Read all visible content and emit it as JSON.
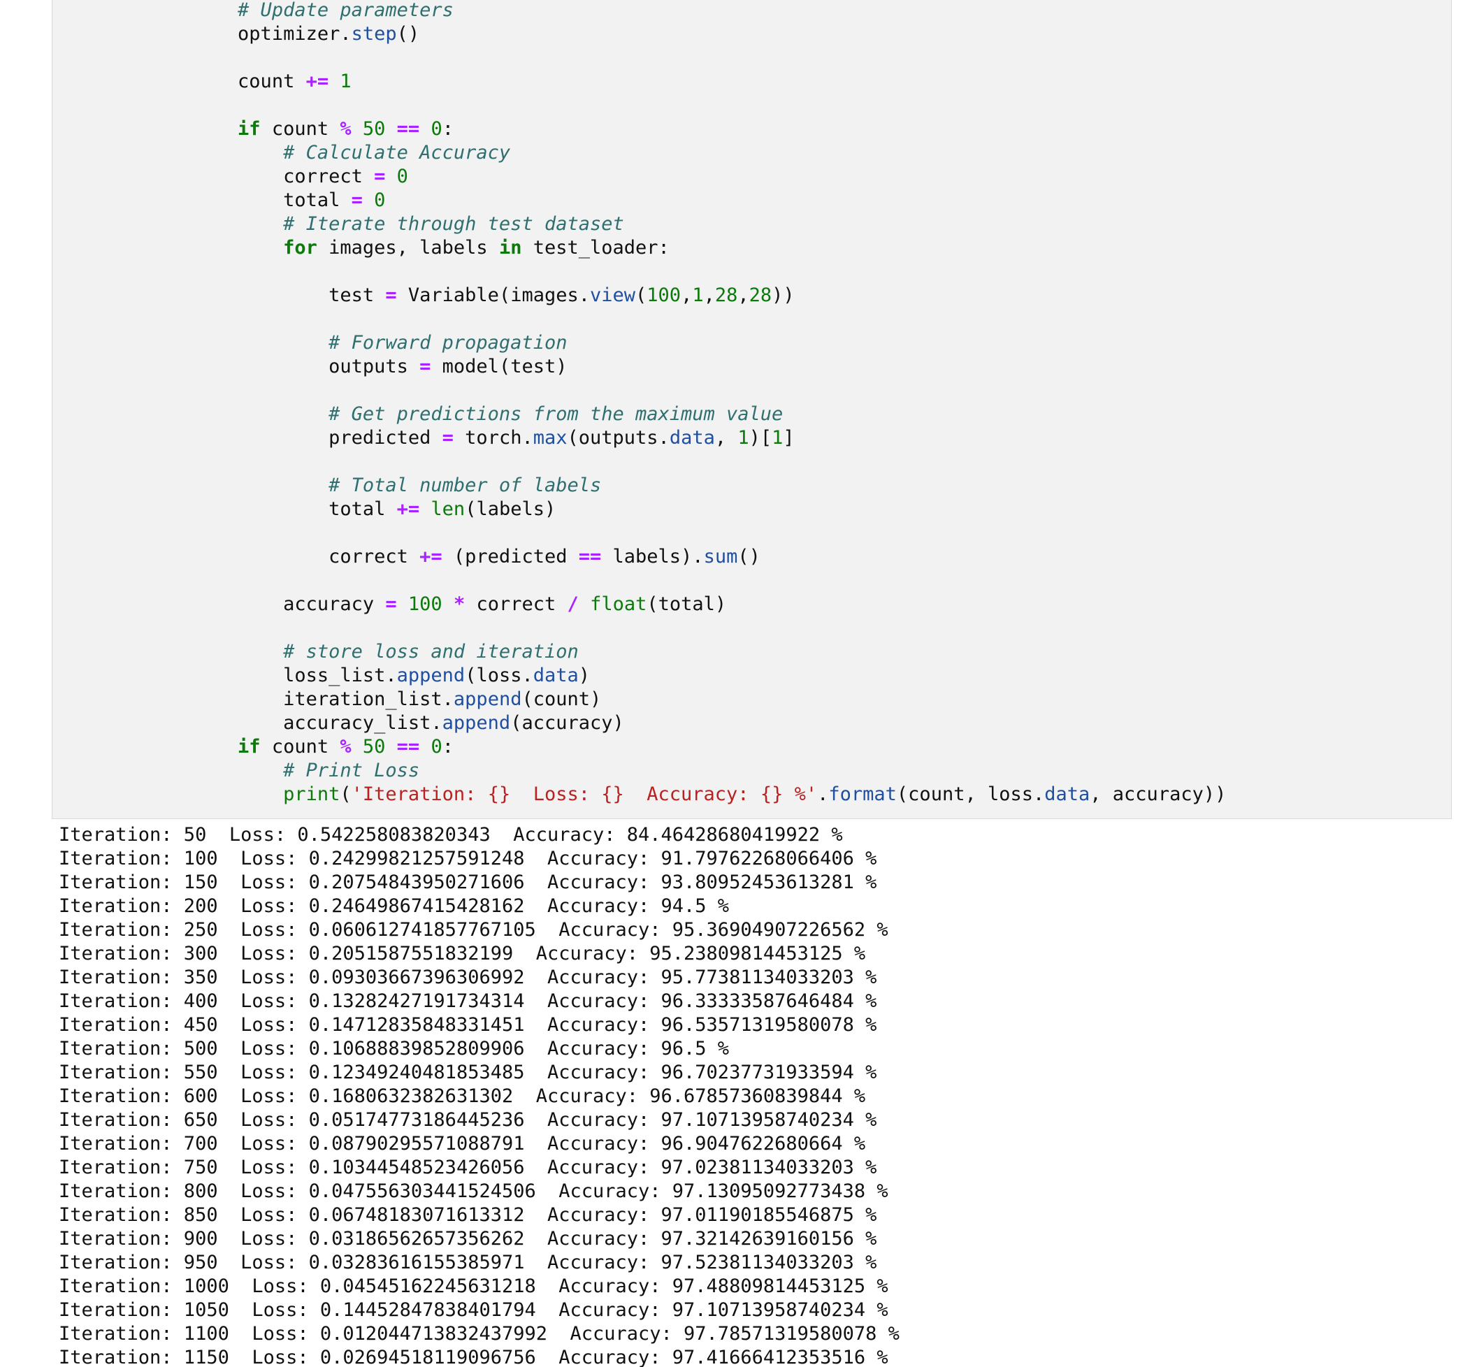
{
  "code_cell": {
    "lines": [
      {
        "indent": "        ",
        "tokens": [
          {
            "t": "# Update parameters",
            "c": "cm"
          }
        ]
      },
      {
        "indent": "        ",
        "tokens": [
          {
            "t": "optimizer.",
            "c": ""
          },
          {
            "t": "step",
            "c": "at"
          },
          {
            "t": "()",
            "c": ""
          }
        ]
      },
      {
        "indent": "",
        "tokens": []
      },
      {
        "indent": "        ",
        "tokens": [
          {
            "t": "count ",
            "c": ""
          },
          {
            "t": "+=",
            "c": "op"
          },
          {
            "t": " ",
            "c": ""
          },
          {
            "t": "1",
            "c": "num"
          }
        ]
      },
      {
        "indent": "",
        "tokens": []
      },
      {
        "indent": "        ",
        "tokens": [
          {
            "t": "if",
            "c": "kw"
          },
          {
            "t": " count ",
            "c": ""
          },
          {
            "t": "%",
            "c": "op"
          },
          {
            "t": " ",
            "c": ""
          },
          {
            "t": "50",
            "c": "num"
          },
          {
            "t": " ",
            "c": ""
          },
          {
            "t": "==",
            "c": "op"
          },
          {
            "t": " ",
            "c": ""
          },
          {
            "t": "0",
            "c": "num"
          },
          {
            "t": ":",
            "c": ""
          }
        ]
      },
      {
        "indent": "            ",
        "tokens": [
          {
            "t": "# Calculate Accuracy",
            "c": "cm"
          }
        ]
      },
      {
        "indent": "            ",
        "tokens": [
          {
            "t": "correct ",
            "c": ""
          },
          {
            "t": "=",
            "c": "op"
          },
          {
            "t": " ",
            "c": ""
          },
          {
            "t": "0",
            "c": "num"
          }
        ]
      },
      {
        "indent": "            ",
        "tokens": [
          {
            "t": "total ",
            "c": ""
          },
          {
            "t": "=",
            "c": "op"
          },
          {
            "t": " ",
            "c": ""
          },
          {
            "t": "0",
            "c": "num"
          }
        ]
      },
      {
        "indent": "            ",
        "tokens": [
          {
            "t": "# Iterate through test dataset",
            "c": "cm"
          }
        ]
      },
      {
        "indent": "            ",
        "tokens": [
          {
            "t": "for",
            "c": "kw"
          },
          {
            "t": " images, labels ",
            "c": ""
          },
          {
            "t": "in",
            "c": "kw"
          },
          {
            "t": " test_loader:",
            "c": ""
          }
        ]
      },
      {
        "indent": "",
        "tokens": []
      },
      {
        "indent": "                ",
        "tokens": [
          {
            "t": "test ",
            "c": ""
          },
          {
            "t": "=",
            "c": "op"
          },
          {
            "t": " Variable(images.",
            "c": ""
          },
          {
            "t": "view",
            "c": "at"
          },
          {
            "t": "(",
            "c": ""
          },
          {
            "t": "100",
            "c": "num"
          },
          {
            "t": ",",
            "c": ""
          },
          {
            "t": "1",
            "c": "num"
          },
          {
            "t": ",",
            "c": ""
          },
          {
            "t": "28",
            "c": "num"
          },
          {
            "t": ",",
            "c": ""
          },
          {
            "t": "28",
            "c": "num"
          },
          {
            "t": "))",
            "c": ""
          }
        ]
      },
      {
        "indent": "",
        "tokens": []
      },
      {
        "indent": "                ",
        "tokens": [
          {
            "t": "# Forward propagation",
            "c": "cm"
          }
        ]
      },
      {
        "indent": "                ",
        "tokens": [
          {
            "t": "outputs ",
            "c": ""
          },
          {
            "t": "=",
            "c": "op"
          },
          {
            "t": " model(test)",
            "c": ""
          }
        ]
      },
      {
        "indent": "",
        "tokens": []
      },
      {
        "indent": "                ",
        "tokens": [
          {
            "t": "# Get predictions from the maximum value",
            "c": "cm"
          }
        ]
      },
      {
        "indent": "                ",
        "tokens": [
          {
            "t": "predicted ",
            "c": ""
          },
          {
            "t": "=",
            "c": "op"
          },
          {
            "t": " torch.",
            "c": ""
          },
          {
            "t": "max",
            "c": "at"
          },
          {
            "t": "(outputs.",
            "c": ""
          },
          {
            "t": "data",
            "c": "at"
          },
          {
            "t": ", ",
            "c": ""
          },
          {
            "t": "1",
            "c": "num"
          },
          {
            "t": ")[",
            "c": ""
          },
          {
            "t": "1",
            "c": "num"
          },
          {
            "t": "]",
            "c": ""
          }
        ]
      },
      {
        "indent": "",
        "tokens": []
      },
      {
        "indent": "                ",
        "tokens": [
          {
            "t": "# Total number of labels",
            "c": "cm"
          }
        ]
      },
      {
        "indent": "                ",
        "tokens": [
          {
            "t": "total ",
            "c": ""
          },
          {
            "t": "+=",
            "c": "op"
          },
          {
            "t": " ",
            "c": ""
          },
          {
            "t": "len",
            "c": "bi"
          },
          {
            "t": "(labels)",
            "c": ""
          }
        ]
      },
      {
        "indent": "",
        "tokens": []
      },
      {
        "indent": "                ",
        "tokens": [
          {
            "t": "correct ",
            "c": ""
          },
          {
            "t": "+=",
            "c": "op"
          },
          {
            "t": " (predicted ",
            "c": ""
          },
          {
            "t": "==",
            "c": "op"
          },
          {
            "t": " labels).",
            "c": ""
          },
          {
            "t": "sum",
            "c": "at"
          },
          {
            "t": "()",
            "c": ""
          }
        ]
      },
      {
        "indent": "",
        "tokens": []
      },
      {
        "indent": "            ",
        "tokens": [
          {
            "t": "accuracy ",
            "c": ""
          },
          {
            "t": "=",
            "c": "op"
          },
          {
            "t": " ",
            "c": ""
          },
          {
            "t": "100",
            "c": "num"
          },
          {
            "t": " ",
            "c": ""
          },
          {
            "t": "*",
            "c": "op"
          },
          {
            "t": " correct ",
            "c": ""
          },
          {
            "t": "/",
            "c": "op"
          },
          {
            "t": " ",
            "c": ""
          },
          {
            "t": "float",
            "c": "bi"
          },
          {
            "t": "(total)",
            "c": ""
          }
        ]
      },
      {
        "indent": "",
        "tokens": []
      },
      {
        "indent": "            ",
        "tokens": [
          {
            "t": "# store loss and iteration",
            "c": "cm"
          }
        ]
      },
      {
        "indent": "            ",
        "tokens": [
          {
            "t": "loss_list.",
            "c": ""
          },
          {
            "t": "append",
            "c": "at"
          },
          {
            "t": "(loss.",
            "c": ""
          },
          {
            "t": "data",
            "c": "at"
          },
          {
            "t": ")",
            "c": ""
          }
        ]
      },
      {
        "indent": "            ",
        "tokens": [
          {
            "t": "iteration_list.",
            "c": ""
          },
          {
            "t": "append",
            "c": "at"
          },
          {
            "t": "(count)",
            "c": ""
          }
        ]
      },
      {
        "indent": "            ",
        "tokens": [
          {
            "t": "accuracy_list.",
            "c": ""
          },
          {
            "t": "append",
            "c": "at"
          },
          {
            "t": "(accuracy)",
            "c": ""
          }
        ]
      },
      {
        "indent": "        ",
        "tokens": [
          {
            "t": "if",
            "c": "kw"
          },
          {
            "t": " count ",
            "c": ""
          },
          {
            "t": "%",
            "c": "op"
          },
          {
            "t": " ",
            "c": ""
          },
          {
            "t": "50",
            "c": "num"
          },
          {
            "t": " ",
            "c": ""
          },
          {
            "t": "==",
            "c": "op"
          },
          {
            "t": " ",
            "c": ""
          },
          {
            "t": "0",
            "c": "num"
          },
          {
            "t": ":",
            "c": ""
          }
        ]
      },
      {
        "indent": "            ",
        "tokens": [
          {
            "t": "# Print Loss",
            "c": "cm"
          }
        ]
      },
      {
        "indent": "            ",
        "tokens": [
          {
            "t": "print",
            "c": "bi"
          },
          {
            "t": "(",
            "c": ""
          },
          {
            "t": "'Iteration: {}  Loss: {}  Accuracy: {} %'",
            "c": "st"
          },
          {
            "t": ".",
            "c": ""
          },
          {
            "t": "format",
            "c": "at"
          },
          {
            "t": "(count, loss.",
            "c": ""
          },
          {
            "t": "data",
            "c": "at"
          },
          {
            "t": ", accuracy))",
            "c": ""
          }
        ]
      }
    ]
  },
  "output": {
    "lines": [
      "Iteration: 50  Loss: 0.542258083820343  Accuracy: 84.46428680419922 %",
      "Iteration: 100  Loss: 0.24299821257591248  Accuracy: 91.79762268066406 %",
      "Iteration: 150  Loss: 0.20754843950271606  Accuracy: 93.80952453613281 %",
      "Iteration: 200  Loss: 0.24649867415428162  Accuracy: 94.5 %",
      "Iteration: 250  Loss: 0.060612741857767105  Accuracy: 95.36904907226562 %",
      "Iteration: 300  Loss: 0.2051587551832199  Accuracy: 95.23809814453125 %",
      "Iteration: 350  Loss: 0.09303667396306992  Accuracy: 95.77381134033203 %",
      "Iteration: 400  Loss: 0.13282427191734314  Accuracy: 96.33333587646484 %",
      "Iteration: 450  Loss: 0.14712835848331451  Accuracy: 96.53571319580078 %",
      "Iteration: 500  Loss: 0.10688839852809906  Accuracy: 96.5 %",
      "Iteration: 550  Loss: 0.12349240481853485  Accuracy: 96.70237731933594 %",
      "Iteration: 600  Loss: 0.1680632382631302  Accuracy: 96.67857360839844 %",
      "Iteration: 650  Loss: 0.05174773186445236  Accuracy: 97.10713958740234 %",
      "Iteration: 700  Loss: 0.08790295571088791  Accuracy: 96.9047622680664 %",
      "Iteration: 750  Loss: 0.10344548523426056  Accuracy: 97.02381134033203 %",
      "Iteration: 800  Loss: 0.047556303441524506  Accuracy: 97.13095092773438 %",
      "Iteration: 850  Loss: 0.06748183071613312  Accuracy: 97.01190185546875 %",
      "Iteration: 900  Loss: 0.03186562657356262  Accuracy: 97.32142639160156 %",
      "Iteration: 950  Loss: 0.03283616155385971  Accuracy: 97.52381134033203 %",
      "Iteration: 1000  Loss: 0.04545162245631218  Accuracy: 97.48809814453125 %",
      "Iteration: 1050  Loss: 0.14452847838401794  Accuracy: 97.10713958740234 %",
      "Iteration: 1100  Loss: 0.012044713832437992  Accuracy: 97.78571319580078 %",
      "Iteration: 1150  Loss: 0.02694518119096756  Accuracy: 97.41666412353516 %"
    ]
  }
}
